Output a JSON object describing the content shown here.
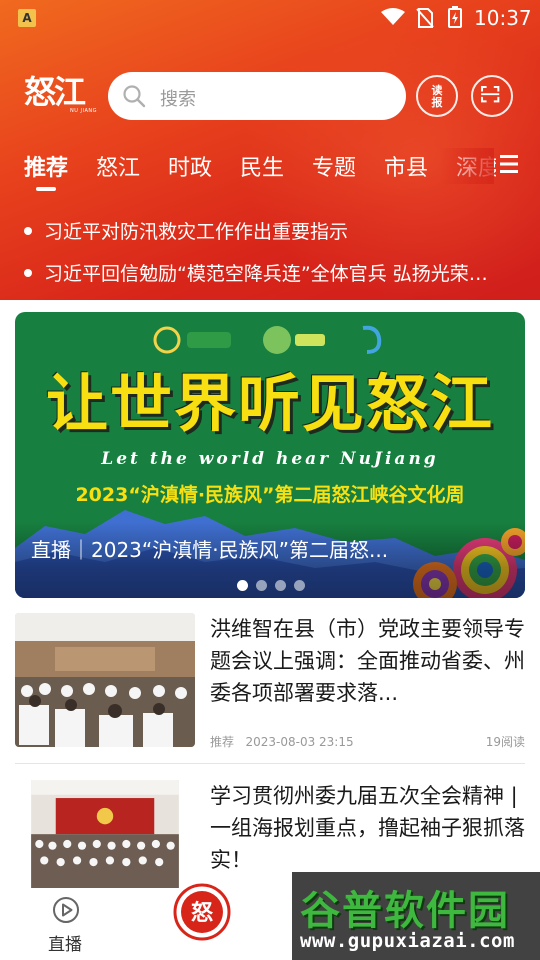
{
  "status_bar": {
    "app_badge": "A",
    "time": "10:37",
    "icons": [
      "wifi-icon",
      "no-sim-icon",
      "battery-charging-icon"
    ]
  },
  "header": {
    "logo_text": "怒江",
    "logo_subtext": "NU JIANG",
    "search_placeholder": "搜索",
    "read_button_label": [
      "读",
      "报"
    ],
    "scan_icon": "scan-icon",
    "colors": {
      "primary_red": "#d8251a",
      "orange": "#f06a1f"
    }
  },
  "tabs": {
    "items": [
      "推荐",
      "怒江",
      "时政",
      "民生",
      "专题",
      "市县",
      "深度"
    ],
    "active_index": 0,
    "menu_icon": "menu-icon"
  },
  "headlines": [
    "习近平对防汛救灾工作作出重要指示",
    "习近平回信勉励“模范空降兵连”全体官兵 弘扬光荣传统"
  ],
  "banner": {
    "title": "让世界听见怒江",
    "title_en": "Let the world hear NuJiang",
    "subtitle": "2023“沪滇情·民族风”第二届怒江峡谷文化周",
    "caption": "直播｜2023“沪滇情·民族风”第二届怒...",
    "dots_count": 4,
    "active_dot": 0,
    "colors": {
      "bg": "#177f3f",
      "title": "#f8df12"
    }
  },
  "news": [
    {
      "title": "洪维智在县（市）党政主要领导专题会议上强调：全面推动省委、州委各项部署要求落...",
      "tag": "推荐",
      "datetime": "2023-08-03 23:15",
      "reads": "19阅读"
    },
    {
      "title": "学习贯彻州委九届五次全会精神 | 一组海报划重点，撸起袖子狠抓落实！",
      "tag": "",
      "datetime": "",
      "reads": ""
    }
  ],
  "bottom_nav": {
    "live_label": "直播",
    "center_logo": "怒"
  },
  "watermark": {
    "title": "谷普软件园",
    "url": "www.gupuxiazai.com"
  }
}
